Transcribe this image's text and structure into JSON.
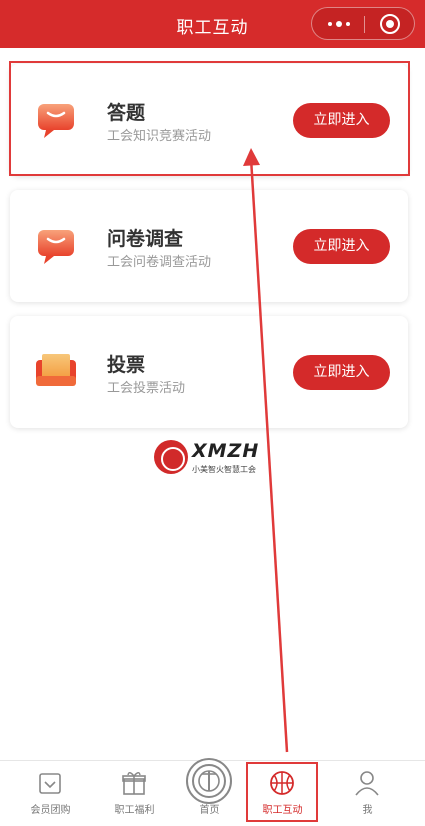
{
  "header": {
    "title": "职工互动"
  },
  "cards": [
    {
      "name": "答题",
      "desc": "工会知识竞赛活动",
      "button": "立即进入",
      "icon": "chat-icon"
    },
    {
      "name": "问卷调查",
      "desc": "工会问卷调查活动",
      "button": "立即进入",
      "icon": "chat-icon"
    },
    {
      "name": "投票",
      "desc": "工会投票活动",
      "button": "立即进入",
      "icon": "ballot-icon"
    }
  ],
  "logo": {
    "brand": "XMZH",
    "sub": "小美智火智慧工会"
  },
  "tabs": [
    {
      "label": "会员团购",
      "icon": "shopping-bag-icon"
    },
    {
      "label": "职工福利",
      "icon": "gift-icon"
    },
    {
      "label": "首页",
      "icon": "home-emblem-icon"
    },
    {
      "label": "职工互动",
      "icon": "basketball-icon"
    },
    {
      "label": "我",
      "icon": "person-icon"
    }
  ],
  "colors": {
    "primary": "#d42a2a",
    "highlight": "#e03a3a"
  }
}
